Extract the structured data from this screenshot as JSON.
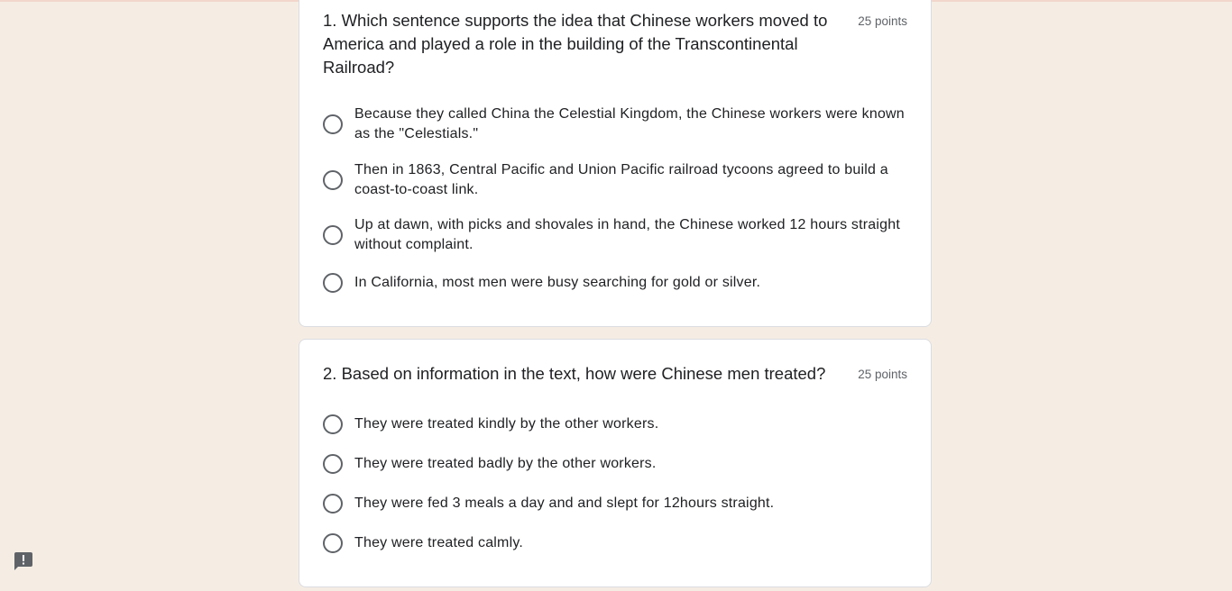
{
  "questions": [
    {
      "title": "1. Which sentence supports the idea that Chinese workers moved to America and played a role in the building of the Transcontinental Railroad?",
      "points": "25 points",
      "options": [
        "Because they called China the Celestial Kingdom, the Chinese workers were known as the \"Celestials.\"",
        "Then in 1863, Central Pacific and Union Pacific railroad tycoons agreed to build a coast-to-coast link.",
        "Up at dawn, with picks and shovales in hand, the Chinese worked 12 hours straight without complaint.",
        "In California, most men were busy searching for gold or silver."
      ]
    },
    {
      "title": "2. Based on information in the text, how were Chinese men treated?",
      "points": "25 points",
      "options": [
        "They were treated kindly by the other workers.",
        "They were treated badly by the other workers.",
        "They were fed 3 meals a day and and slept for 12hours straight.",
        "They were treated calmly."
      ]
    }
  ],
  "feedback_icon": "report-problem-icon",
  "colors": {
    "background": "#f5ede4",
    "radio_border": "#5f6368",
    "feedback_icon": "#5f6368"
  }
}
